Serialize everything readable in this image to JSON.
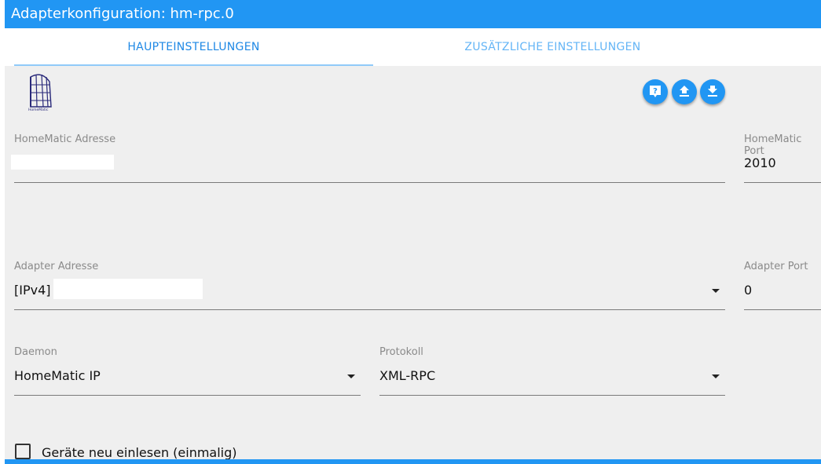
{
  "header": {
    "title": "Adapterkonfiguration: hm-rpc.0"
  },
  "tabs": [
    {
      "label": "HAUPTEINSTELLUNGEN"
    },
    {
      "label": "ZUSÄTZLICHE EINSTELLUNGEN"
    }
  ],
  "toolbar": {
    "help_icon": "help-icon",
    "upload_icon": "upload-icon",
    "download_icon": "download-icon"
  },
  "fields": {
    "homematic_address": {
      "label": "HomeMatic Adresse",
      "value": ""
    },
    "homematic_port": {
      "label": "HomeMatic Port",
      "value": "2010"
    },
    "adapter_address": {
      "label": "Adapter Adresse",
      "prefix": "[IPv4]",
      "value": ""
    },
    "adapter_port": {
      "label": "Adapter Port",
      "value": "0"
    },
    "daemon": {
      "label": "Daemon",
      "value": "HomeMatic IP"
    },
    "protocol": {
      "label": "Protokoll",
      "value": "XML-RPC"
    }
  },
  "checkbox": {
    "label": "Geräte neu einlesen (einmalig)",
    "checked": false
  },
  "colors": {
    "accent": "#2196f3",
    "background": "#efefef"
  }
}
